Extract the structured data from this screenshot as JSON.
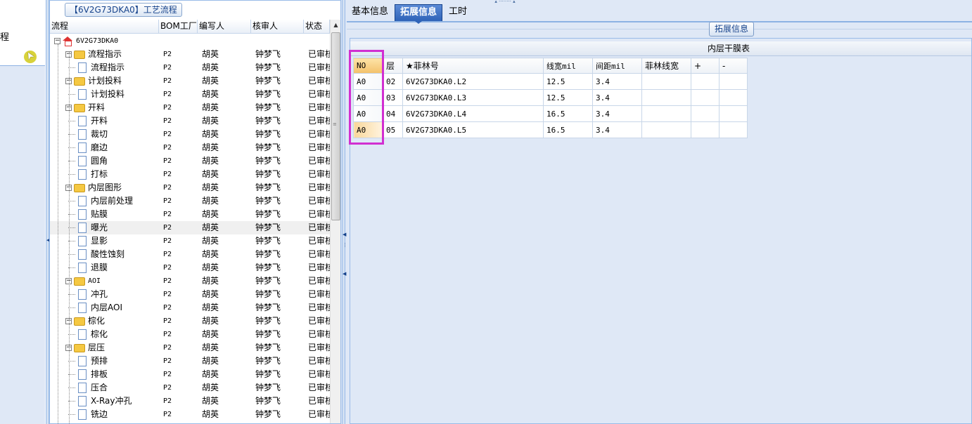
{
  "left_stub": {
    "label": "程"
  },
  "tree": {
    "title": "【6V2G73DKA0】工艺流程",
    "columns": [
      "流程",
      "BOM工厂",
      "编写人",
      "核审人",
      "状态"
    ],
    "rows": [
      {
        "name": "6V2G73DKA0",
        "level": 0,
        "kind": "root",
        "bom": "",
        "author": "",
        "reviewer": "",
        "status": ""
      },
      {
        "name": "流程指示",
        "level": 1,
        "kind": "folder",
        "bom": "P2",
        "author": "胡英",
        "reviewer": "钟梦飞",
        "status": "已审核"
      },
      {
        "name": "流程指示",
        "level": 2,
        "kind": "doc",
        "bom": "P2",
        "author": "胡英",
        "reviewer": "钟梦飞",
        "status": "已审核"
      },
      {
        "name": "计划投料",
        "level": 1,
        "kind": "folder",
        "bom": "P2",
        "author": "胡英",
        "reviewer": "钟梦飞",
        "status": "已审核"
      },
      {
        "name": "计划投料",
        "level": 2,
        "kind": "doc",
        "bom": "P2",
        "author": "胡英",
        "reviewer": "钟梦飞",
        "status": "已审核"
      },
      {
        "name": "开料",
        "level": 1,
        "kind": "folder",
        "bom": "P2",
        "author": "胡英",
        "reviewer": "钟梦飞",
        "status": "已审核"
      },
      {
        "name": "开料",
        "level": 2,
        "kind": "doc",
        "bom": "P2",
        "author": "胡英",
        "reviewer": "钟梦飞",
        "status": "已审核"
      },
      {
        "name": "裁切",
        "level": 2,
        "kind": "doc",
        "bom": "P2",
        "author": "胡英",
        "reviewer": "钟梦飞",
        "status": "已审核"
      },
      {
        "name": "磨边",
        "level": 2,
        "kind": "doc",
        "bom": "P2",
        "author": "胡英",
        "reviewer": "钟梦飞",
        "status": "已审核"
      },
      {
        "name": "圆角",
        "level": 2,
        "kind": "doc",
        "bom": "P2",
        "author": "胡英",
        "reviewer": "钟梦飞",
        "status": "已审核"
      },
      {
        "name": "打标",
        "level": 2,
        "kind": "doc",
        "bom": "P2",
        "author": "胡英",
        "reviewer": "钟梦飞",
        "status": "已审核"
      },
      {
        "name": "内层图形",
        "level": 1,
        "kind": "folder",
        "bom": "P2",
        "author": "胡英",
        "reviewer": "钟梦飞",
        "status": "已审核"
      },
      {
        "name": "内层前处理",
        "level": 2,
        "kind": "doc",
        "bom": "P2",
        "author": "胡英",
        "reviewer": "钟梦飞",
        "status": "已审核"
      },
      {
        "name": "贴膜",
        "level": 2,
        "kind": "doc",
        "bom": "P2",
        "author": "胡英",
        "reviewer": "钟梦飞",
        "status": "已审核"
      },
      {
        "name": "曝光",
        "level": 2,
        "kind": "doc",
        "bom": "P2",
        "author": "胡英",
        "reviewer": "钟梦飞",
        "status": "已审核",
        "selected": true
      },
      {
        "name": "显影",
        "level": 2,
        "kind": "doc",
        "bom": "P2",
        "author": "胡英",
        "reviewer": "钟梦飞",
        "status": "已审核"
      },
      {
        "name": "酸性蚀刻",
        "level": 2,
        "kind": "doc",
        "bom": "P2",
        "author": "胡英",
        "reviewer": "钟梦飞",
        "status": "已审核"
      },
      {
        "name": "退膜",
        "level": 2,
        "kind": "doc",
        "bom": "P2",
        "author": "胡英",
        "reviewer": "钟梦飞",
        "status": "已审核"
      },
      {
        "name": "AOI",
        "level": 1,
        "kind": "folder",
        "bom": "P2",
        "author": "胡英",
        "reviewer": "钟梦飞",
        "status": "已审核",
        "code": true
      },
      {
        "name": "冲孔",
        "level": 2,
        "kind": "doc",
        "bom": "P2",
        "author": "胡英",
        "reviewer": "钟梦飞",
        "status": "已审核"
      },
      {
        "name": "内层AOI",
        "level": 2,
        "kind": "doc",
        "bom": "P2",
        "author": "胡英",
        "reviewer": "钟梦飞",
        "status": "已审核"
      },
      {
        "name": "棕化",
        "level": 1,
        "kind": "folder",
        "bom": "P2",
        "author": "胡英",
        "reviewer": "钟梦飞",
        "status": "已审核"
      },
      {
        "name": "棕化",
        "level": 2,
        "kind": "doc",
        "bom": "P2",
        "author": "胡英",
        "reviewer": "钟梦飞",
        "status": "已审核"
      },
      {
        "name": "层压",
        "level": 1,
        "kind": "folder",
        "bom": "P2",
        "author": "胡英",
        "reviewer": "钟梦飞",
        "status": "已审核"
      },
      {
        "name": "预排",
        "level": 2,
        "kind": "doc",
        "bom": "P2",
        "author": "胡英",
        "reviewer": "钟梦飞",
        "status": "已审核"
      },
      {
        "name": "排板",
        "level": 2,
        "kind": "doc",
        "bom": "P2",
        "author": "胡英",
        "reviewer": "钟梦飞",
        "status": "已审核"
      },
      {
        "name": "压合",
        "level": 2,
        "kind": "doc",
        "bom": "P2",
        "author": "胡英",
        "reviewer": "钟梦飞",
        "status": "已审核"
      },
      {
        "name": "X-Ray冲孔",
        "level": 2,
        "kind": "doc",
        "bom": "P2",
        "author": "胡英",
        "reviewer": "钟梦飞",
        "status": "已审核"
      },
      {
        "name": "铣边",
        "level": 2,
        "kind": "doc",
        "bom": "P2",
        "author": "胡英",
        "reviewer": "钟梦飞",
        "status": "已审核"
      }
    ]
  },
  "tabs": [
    {
      "label": "基本信息",
      "active": false
    },
    {
      "label": "拓展信息",
      "active": true
    },
    {
      "label": "工时",
      "active": false
    }
  ],
  "ext_button": "拓展信息",
  "grid": {
    "title": "内层干膜表",
    "columns": [
      "NO",
      "层",
      "★菲林号",
      "线宽mil",
      "间距mil",
      "菲林线宽",
      "+",
      "-"
    ],
    "rows": [
      {
        "no": "A0",
        "layer": "02",
        "film": "6V2G73DKA0.L2",
        "line_width": "12.5",
        "spacing": "3.4",
        "film_width": "",
        "selected": false
      },
      {
        "no": "A0",
        "layer": "03",
        "film": "6V2G73DKA0.L3",
        "line_width": "12.5",
        "spacing": "3.4",
        "film_width": "",
        "selected": false
      },
      {
        "no": "A0",
        "layer": "04",
        "film": "6V2G73DKA0.L4",
        "line_width": "16.5",
        "spacing": "3.4",
        "film_width": "",
        "selected": false
      },
      {
        "no": "A0",
        "layer": "05",
        "film": "6V2G73DKA0.L5",
        "line_width": "16.5",
        "spacing": "3.4",
        "film_width": "",
        "selected": true
      }
    ]
  },
  "colors": {
    "highlight": "#d12fd1",
    "tab_active": "#2e63b8",
    "selected_cell": "#f9d79a"
  }
}
